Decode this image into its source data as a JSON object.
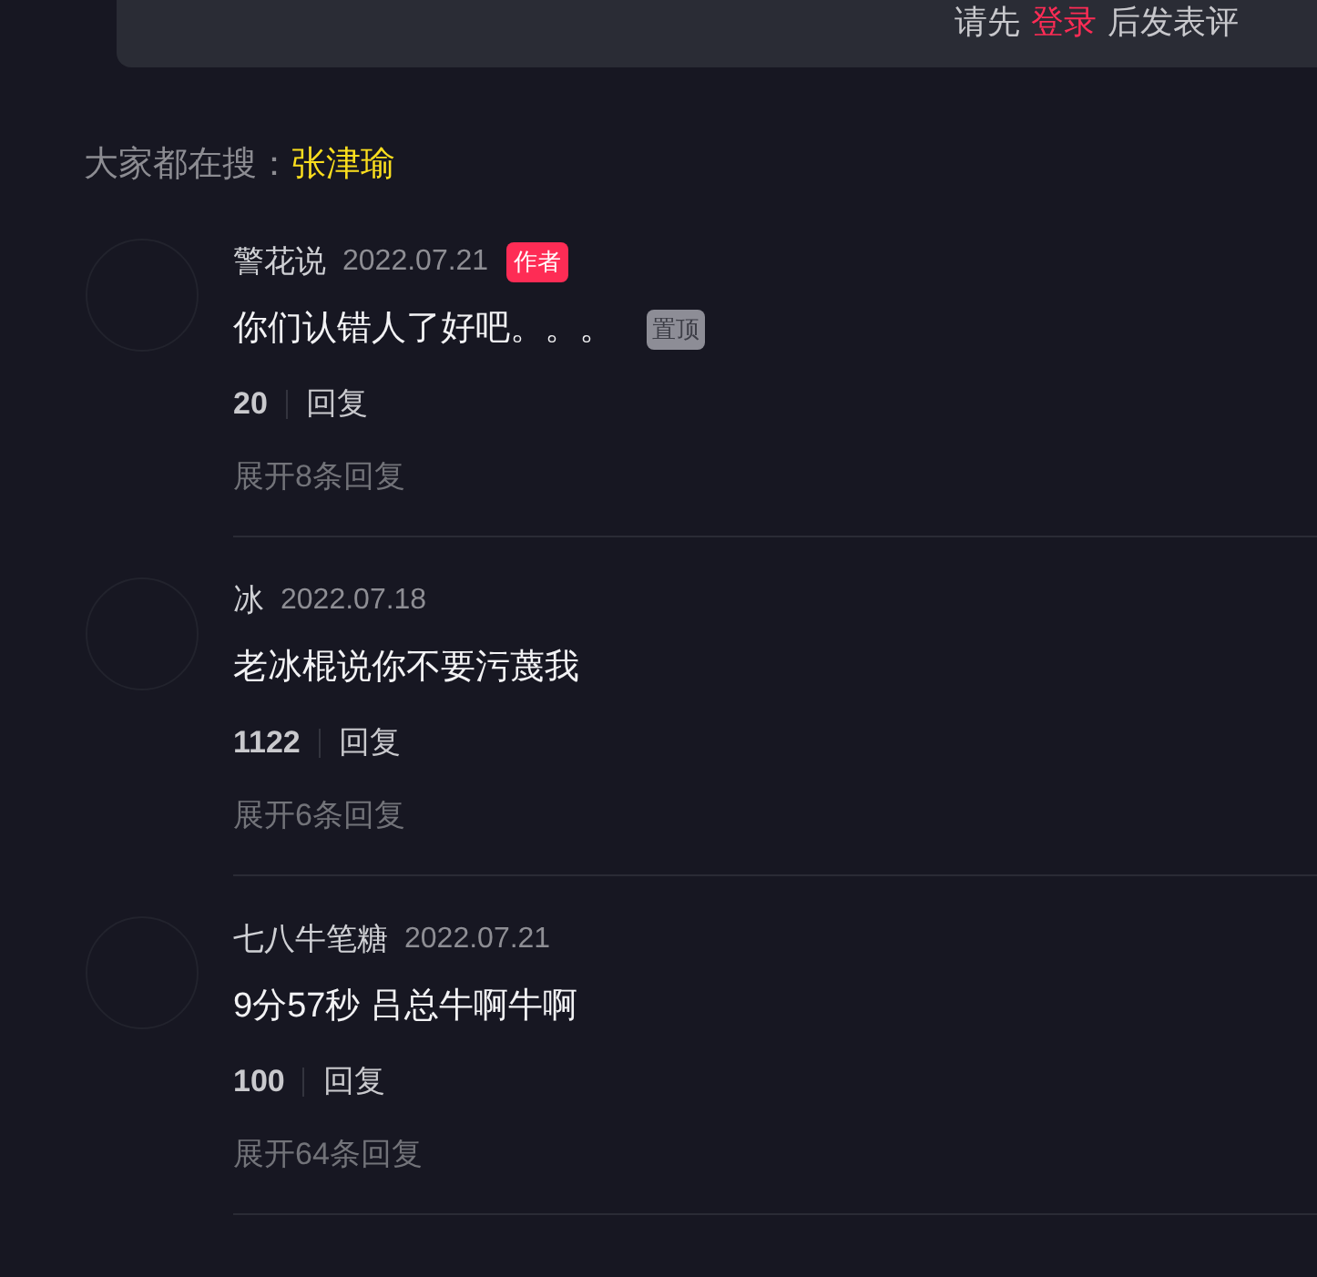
{
  "login_prompt": {
    "before": "请先",
    "link": "登录",
    "after": "后发表评"
  },
  "trending": {
    "label": "大家都在搜：",
    "term": "张津瑜"
  },
  "comments": [
    {
      "author": "警花说",
      "date": "2022.07.21",
      "author_badge": "作者",
      "text": "你们认错人了好吧。。。",
      "pinned_badge": "置顶",
      "likes": "20",
      "reply": "回复",
      "expand": "展开8条回复"
    },
    {
      "author": "冰",
      "date": "2022.07.18",
      "text": "老冰棍说你不要污蔑我",
      "likes": "1122",
      "reply": "回复",
      "expand": "展开6条回复"
    },
    {
      "author": "七八牛笔糖",
      "date": "2022.07.21",
      "text": "9分57秒 吕总牛啊牛啊",
      "likes": "100",
      "reply": "回复",
      "expand": "展开64条回复"
    }
  ]
}
